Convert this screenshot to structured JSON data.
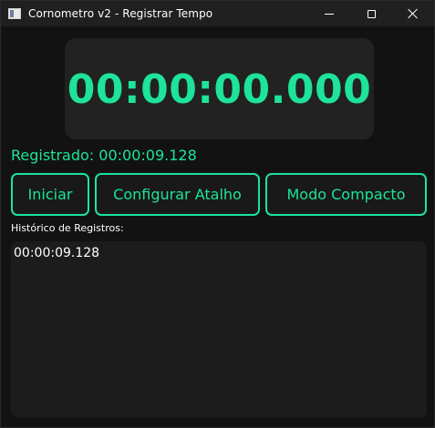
{
  "window": {
    "title": "Cornometro v2 - Registrar Tempo",
    "controls": {
      "minimize_icon": "minimize-icon",
      "maximize_icon": "maximize-icon",
      "close_icon": "close-icon"
    }
  },
  "timer": {
    "display": "00:00:00.000"
  },
  "status": {
    "registered": "Registrado: 00:00:09.128"
  },
  "buttons": {
    "start": "Iniciar",
    "configure_shortcut": "Configurar Atalho",
    "compact_mode": "Modo Compacto"
  },
  "history": {
    "label": "Histórico de Registros:",
    "items": [
      "00:00:09.128"
    ]
  },
  "colors": {
    "accent": "#1ee39a",
    "background": "#121212",
    "panel": "#222222",
    "titlebar": "#202020"
  }
}
